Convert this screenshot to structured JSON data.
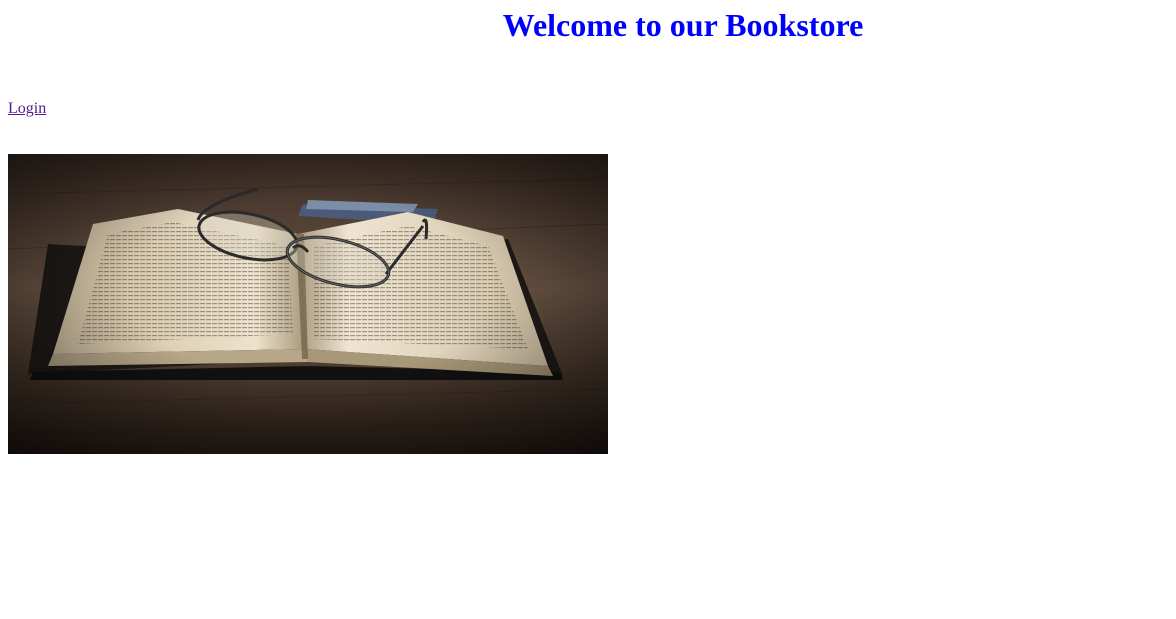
{
  "header": {
    "title": "Welcome to our Bookstore",
    "title_color": "#0000ff"
  },
  "nav": {
    "login_label": "Login",
    "link_color": "#551a8b"
  },
  "hero": {
    "subject": "open book with reading glasses on wooden table",
    "icon": "book-photo"
  }
}
